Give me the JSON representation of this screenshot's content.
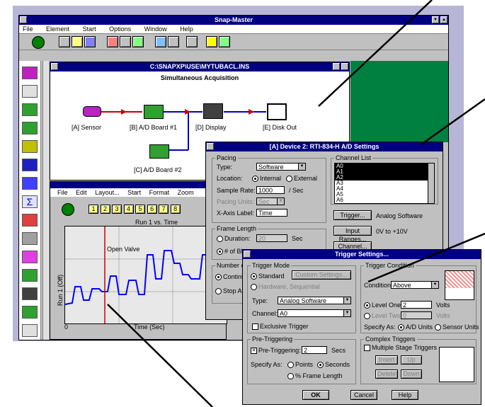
{
  "main_window": {
    "title": "Snap-Master",
    "menu": [
      "File",
      "Element",
      "Start",
      "Options",
      "Window",
      "Help"
    ]
  },
  "instrument": {
    "path": "C:\\SNAPXP\\USE\\MYTUBACL.INS",
    "heading": "Simultaneous Acquisition",
    "blocks": [
      "[A] Sensor",
      "[B] A/D Board #1",
      "[D] Display",
      "[E] Disk Out",
      "[C] A/D Board #2"
    ]
  },
  "display_window": {
    "menu": [
      "File",
      "Edit",
      "Layout...",
      "Start",
      "Format",
      "Zoom"
    ],
    "channel_buttons": [
      "1",
      "2",
      "3",
      "4",
      "5",
      "6",
      "7",
      "8"
    ],
    "plot_title": "Run 1 vs. Time",
    "annotation": "Open Valve",
    "xlabel": "Time (Sec)",
    "ylabel": "Run 1 (Off)",
    "x_start": "0"
  },
  "ad_settings": {
    "title": "[A] Device 2: RTI-834-H A/D Settings",
    "pacing": {
      "group": "Pacing",
      "type_label": "Type:",
      "type_value": "Software",
      "location_label": "Location:",
      "internal": "Internal",
      "external": "External",
      "sample_rate_label": "Sample Rate:",
      "sample_rate_value": "1000",
      "sample_rate_unit": "/ Sec",
      "pacing_units_label": "Pacing Units:",
      "pacing_units_value": "Sec",
      "xaxis_label": "X-Axis Label:",
      "xaxis_value": "Time"
    },
    "frame": {
      "group": "Frame Length",
      "duration_label": "Duration:",
      "duration_value": "20",
      "duration_unit": "Sec",
      "count_label": "# of Bl"
    },
    "number_of": {
      "group": "Number of",
      "opt1": "Continu",
      "opt2": "Stop Af"
    },
    "channel_list": {
      "group": "Channel List",
      "items": [
        "A0",
        "A1",
        "A2",
        "A3",
        "A4",
        "A5",
        "A6"
      ]
    },
    "trigger_button": "Trigger...",
    "trigger_text": "Analog Software",
    "input_ranges_button": "Input Ranges...",
    "range_text": "0V to +10V",
    "third_button": "Channel..."
  },
  "trigger": {
    "title": "Trigger Settings...",
    "mode": {
      "group": "Trigger Mode",
      "standard": "Standard",
      "custom_btn": "Custom Settings...",
      "hardware": "Hardware, Sequential",
      "type_label": "Type:",
      "type_value": "Analog Software",
      "channel_label": "Channel:",
      "channel_value": "A0",
      "exclusive": "Exclusive Trigger"
    },
    "condition": {
      "group": "Trigger Condition",
      "condition_label": "Condition:",
      "condition_value": "Above",
      "level_one_label": "Level One:",
      "level_one_value": "2",
      "level_one_unit": "Volts",
      "level_two_label": "Level Two:",
      "level_two_value": "0",
      "level_two_unit": "Volts",
      "specify_label": "Specify As:",
      "ad_units": "A/D Units",
      "sensor_units": "Sensor Units"
    },
    "pre": {
      "group": "Pre-Triggering",
      "pre_label": "Pre-Triggering:",
      "pre_value": "2",
      "pre_unit": "Secs",
      "specify_label": "Specify As:",
      "points": "Points",
      "seconds": "Seconds",
      "frame_pct": "% Frame Length"
    },
    "complex": {
      "group": "Complex Triggers",
      "multiple": "Multiple Stage Triggers",
      "insert": "Insert",
      "up": "Up",
      "delete": "Delete",
      "down": "Down"
    },
    "ok": "OK",
    "cancel": "Cancel",
    "help": "Help"
  },
  "colors": {
    "titlebar": "#000080",
    "green_pane": "#008040",
    "backdrop": "#b7b6d6",
    "trace": "#0000ff",
    "cursor": "#cc0000"
  }
}
